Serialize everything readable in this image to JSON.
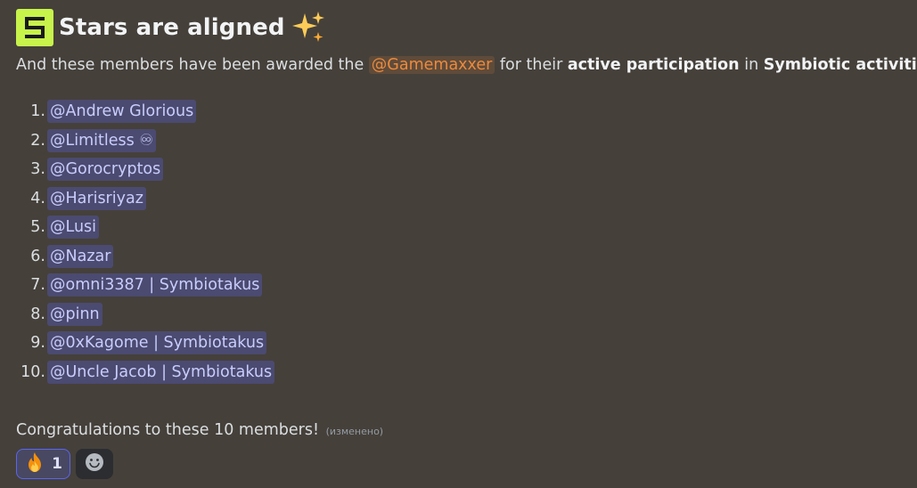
{
  "heading": {
    "text": "Stars are aligned",
    "logo_icon": "symbiotic-logo-icon",
    "sparkle_icon": "sparkles-icon"
  },
  "intro": {
    "prefix": "And these members have been awarded the ",
    "role": "@Gamemaxxer",
    "middle1": " for their ",
    "bold1": "active participation",
    "middle2": " in ",
    "bold2": "Symbiotic activities",
    "suffix": "."
  },
  "members": [
    {
      "num": "1.",
      "name": "@Andrew Glorious"
    },
    {
      "num": "2.",
      "name": "@Limitless ♾"
    },
    {
      "num": "3.",
      "name": "@Gorocryptos"
    },
    {
      "num": "4.",
      "name": "@Harisriyaz"
    },
    {
      "num": "5.",
      "name": "@Lusi"
    },
    {
      "num": "6.",
      "name": "@Nazar"
    },
    {
      "num": "7.",
      "name": "@omni3387 | Symbiotakus"
    },
    {
      "num": "8.",
      "name": "@pinn"
    },
    {
      "num": "9.",
      "name": "@0xKagome | Symbiotakus"
    },
    {
      "num": "10.",
      "name": "@Uncle Jacob | Symbiotakus"
    }
  ],
  "congrats": {
    "text": "Congratulations to these 10 members!",
    "edited": "(изменено)"
  },
  "reactions": {
    "fire": {
      "icon": "fire-emoji-icon",
      "count": "1"
    },
    "add": {
      "icon": "add-reaction-icon"
    }
  },
  "colors": {
    "background": "#45403a",
    "role_mention": "#ec8a3c",
    "user_mention": "#c9cdfb",
    "logo_green": "#c7f34b"
  }
}
